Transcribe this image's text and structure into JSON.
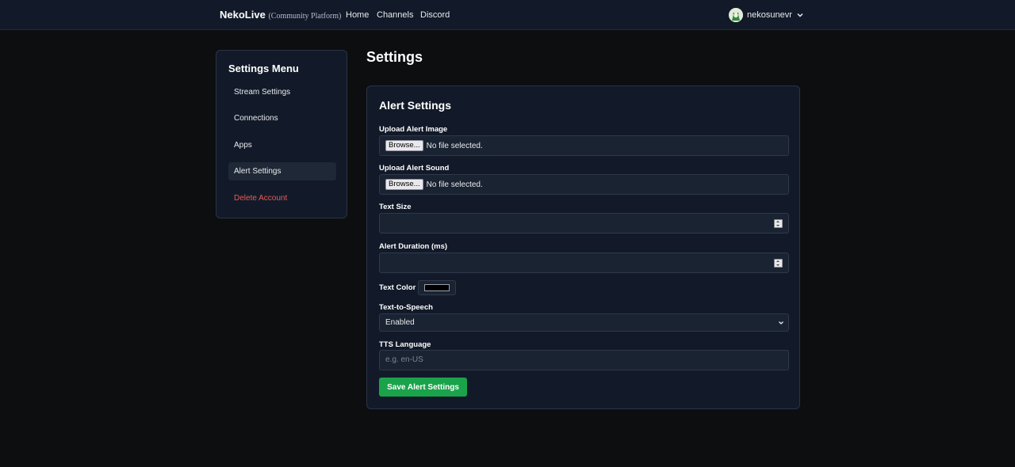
{
  "nav": {
    "brand": "NekoLive",
    "brand_sub": "(Community Platform)",
    "links": [
      "Home",
      "Channels",
      "Discord"
    ],
    "username": "nekosunevr",
    "avatar_icon": "neko-avatar-icon"
  },
  "sidebar": {
    "title": "Settings Menu",
    "items": [
      {
        "label": "Stream Settings",
        "active": false
      },
      {
        "label": "Connections",
        "active": false
      },
      {
        "label": "Apps",
        "active": false
      },
      {
        "label": "Alert Settings",
        "active": true
      },
      {
        "label": "Delete Account",
        "active": false,
        "danger": true
      }
    ]
  },
  "page": {
    "title": "Settings"
  },
  "alert_card": {
    "title": "Alert Settings",
    "upload_image": {
      "label": "Upload Alert Image",
      "button": "Browse...",
      "status": "No file selected."
    },
    "upload_sound": {
      "label": "Upload Alert Sound",
      "button": "Browse...",
      "status": "No file selected."
    },
    "text_size": {
      "label": "Text Size",
      "value": ""
    },
    "alert_duration": {
      "label": "Alert Duration (ms)",
      "value": ""
    },
    "text_color": {
      "label": "Text Color",
      "value": "#000000"
    },
    "tts": {
      "label": "Text-to-Speech",
      "selected": "Enabled"
    },
    "tts_language": {
      "label": "TTS Language",
      "placeholder": "e.g. en-US",
      "value": ""
    },
    "save_button": "Save Alert Settings"
  },
  "colors": {
    "background": "#0d0e10",
    "panel": "#121a29",
    "accent_green": "#1aa34a",
    "danger_red": "#ea5a55"
  }
}
